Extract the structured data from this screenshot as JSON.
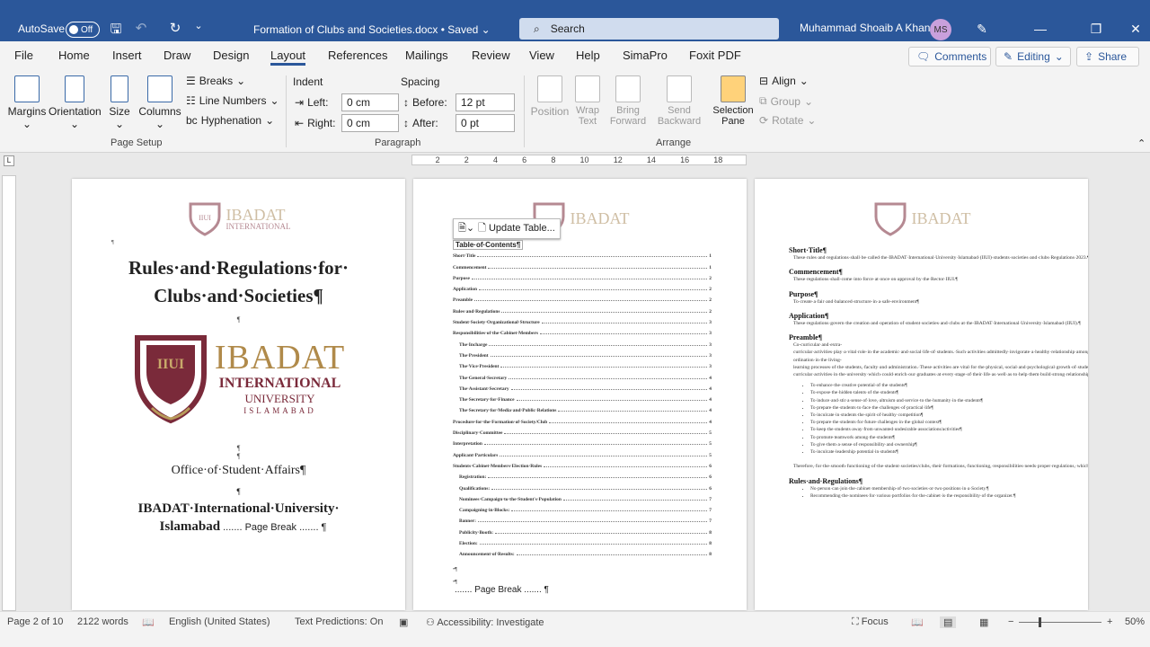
{
  "titlebar": {
    "autosave_label": "AutoSave",
    "autosave_state": "Off",
    "doc_title": "Formation of Clubs and Societies.docx • Saved ⌄",
    "search_placeholder": "Search",
    "user_name": "Muhammad Shoaib A Khan",
    "user_initials": "MS"
  },
  "menu": {
    "items": [
      "File",
      "Home",
      "Insert",
      "Draw",
      "Design",
      "Layout",
      "References",
      "Mailings",
      "Review",
      "View",
      "Help",
      "SimaPro",
      "Foxit PDF"
    ],
    "active": "Layout",
    "comments": "Comments",
    "editing": "Editing",
    "share": "Share"
  },
  "ribbon": {
    "page_setup": {
      "margins": "Margins",
      "orientation": "Orientation",
      "size": "Size",
      "columns": "Columns",
      "breaks": "Breaks",
      "line_numbers": "Line Numbers",
      "hyphenation": "Hyphenation",
      "group": "Page Setup"
    },
    "paragraph": {
      "indent": "Indent",
      "spacing": "Spacing",
      "left_label": "Left:",
      "right_label": "Right:",
      "before_label": "Before:",
      "after_label": "After:",
      "left": "0 cm",
      "right": "0 cm",
      "before": "12 pt",
      "after": "0 pt",
      "group": "Paragraph"
    },
    "arrange": {
      "position": "Position",
      "wrap_text": "Wrap Text",
      "bring_forward": "Bring Forward",
      "send_backward": "Send Backward",
      "selection_pane": "Selection Pane",
      "align": "Align",
      "group_btn": "Group",
      "rotate": "Rotate",
      "group": "Arrange"
    }
  },
  "ruler": {
    "ticks": [
      "2",
      "2",
      "4",
      "6",
      "8",
      "10",
      "12",
      "14",
      "16",
      "18"
    ]
  },
  "page1": {
    "title_line1": "Rules·and·Regulations·for·",
    "title_line2": "Clubs·and·Societies¶",
    "logo_main": "IBADAT",
    "logo_sub1": "INTERNATIONAL",
    "logo_sub2": "UNIVERSITY",
    "logo_sub3": "ISLAMABAD",
    "office": "Office·of·Student·Affairs¶",
    "uni_line1": "IBADAT·International·University·",
    "uni_line2": "Islamabad",
    "page_break": "Page Break"
  },
  "page2": {
    "update_table": "Update Table...",
    "toc_title": "Table·of·Contents¶",
    "toc": [
      {
        "t": "Short·Title",
        "p": "1"
      },
      {
        "t": "Commencement",
        "p": "1"
      },
      {
        "t": "Purpose",
        "p": "2"
      },
      {
        "t": "Application",
        "p": "2"
      },
      {
        "t": "Preamble",
        "p": "2"
      },
      {
        "t": "Rules·and·Regulations",
        "p": "2"
      },
      {
        "t": "Student·Society·Organizational·Structure",
        "p": "3"
      },
      {
        "t": "Responsibilities·of·the·Cabinet·Members",
        "p": "3"
      },
      {
        "t": "The·Incharge",
        "p": "3",
        "i": 1
      },
      {
        "t": "The·President",
        "p": "3",
        "i": 1
      },
      {
        "t": "The·Vice·President",
        "p": "3",
        "i": 1
      },
      {
        "t": "The·General·Secretary",
        "p": "4",
        "i": 1
      },
      {
        "t": "The·Assistant·Secretary",
        "p": "4",
        "i": 1
      },
      {
        "t": "The·Secretary·for·Finance",
        "p": "4",
        "i": 1
      },
      {
        "t": "The·Secretary·for·Media·and·Public·Relations",
        "p": "4",
        "i": 1
      },
      {
        "t": "Procedure·for·the·Formation·of·Society/Club",
        "p": "4"
      },
      {
        "t": "Disciplinary·Committee",
        "p": "5"
      },
      {
        "t": "Interpretation",
        "p": "5"
      },
      {
        "t": "Applicant·Particulars",
        "p": "5"
      },
      {
        "t": "Students·Cabinet·Members·Election·Rules",
        "p": "6"
      },
      {
        "t": "Registration:",
        "p": "6",
        "i": 1
      },
      {
        "t": "Qualifications:",
        "p": "6",
        "i": 1
      },
      {
        "t": "Nominees·Campaign·to·the·Student's·Population",
        "p": "7",
        "i": 1
      },
      {
        "t": "Campaigning·in·Blocks:",
        "p": "7",
        "i": 1
      },
      {
        "t": "Banner:",
        "p": "7",
        "i": 1
      },
      {
        "t": "Publicity·Booth:",
        "p": "8",
        "i": 1
      },
      {
        "t": "Election:",
        "p": "8",
        "i": 1
      },
      {
        "t": "Announcement·of·Results:",
        "p": "8",
        "i": 1
      }
    ],
    "page_break": "Page Break"
  },
  "page3": {
    "sections": [
      {
        "h": "Short·Title¶",
        "p": "These·rules·and·regulations·shall·be·called·the·IBADAT·International·University·Islamabad·(IIUI)·students·societies·and·clubs·Regulations·2023.¶"
      },
      {
        "h": "Commencement¶",
        "p": "These·regulations·shall·come·into·force·at·once·on·approval·by·the·Rector·IIUI.¶"
      },
      {
        "h": "Purpose¶",
        "p": "To·create·a·fair·and·balanced·structure·in·a·safe·environment¶"
      },
      {
        "h": "Application¶",
        "p": "These·regulations·govern·the·creation·and·operation·of·student·societies·and·clubs·at·the·IBADAT·International·University·Islamabad·(IIUI).¶"
      },
      {
        "h": "Preamble¶",
        "p": "Co-curricular·and·extra-curricular·activities·play·a·vital·role·in·the·academic·and·social·life·of·students.·Such·activities·admittedly·invigorate·a·healthy·relationship·among·the·students·and·develop·a·sense·of·co-ordination·in·the·living-learning·processes·of·the·students,·faculty·and·administration.·These·activities·are·vital·for·the·physical,·social·and·psychological·growth·of·students.·Since·the·student·affairs·department·provides·proactive·support·and·capacity·building·services·to·promote·co-curricular·activities·in·the·university·which·could·enrich·our·graduates·at·every·stage·of·their·life·as·well·as·to·help·them·build·strong·relationships·with·their·peers,·faculty,·administration·and·other·stakeholders·with·the·following·aims·and·objectives.¶"
      }
    ],
    "bullets": [
      "To·enhance·the·creative·potential·of·the·students¶",
      "To·expose·the·hidden·talents·of·the·students¶",
      "To·induce·and·stir·a·sense·of·love,·altruism·and·service·to·the·humanity·in·the·students¶",
      "To·prepare·the·students·to·face·the·challenges·of·practical·life¶",
      "To·inculcate·in·students·the·spirit·of·healthy·competition¶",
      "To·prepare·the·students·for·future·challenges·in·the·global·context¶",
      "To·keep·the·students·away·from·unwanted·undesirable·associations/activities¶",
      "To·promote·teamwork·among·the·students¶",
      "To·give·them·a·sense·of·responsibility·and·ownership¶",
      "To·inculcate·leadership·potential·in·students¶"
    ],
    "therefore": "Therefore,·for·the·smooth·functioning·of·the·student·societies/clubs,·their·formations,·functioning,·responsibilities·needs·proper·regulations,·which·are·provided·in·the·following.¶",
    "rules_heading": "Rules·and·Regulations¶",
    "rules": [
      "No·person·can·join·the·cabinet·membership·of·two·societies·or·two·positions·in·a·Society.¶",
      "Recommending·the·nominees·for·various·portfolios·for·the·cabinet·is·the·responsibility·of·the·organizer.¶"
    ]
  },
  "status": {
    "page": "Page 2 of 10",
    "words": "2122 words",
    "language": "English (United States)",
    "predictions": "Text Predictions: On",
    "accessibility": "Accessibility: Investigate",
    "focus": "Focus",
    "zoom": "50%"
  }
}
